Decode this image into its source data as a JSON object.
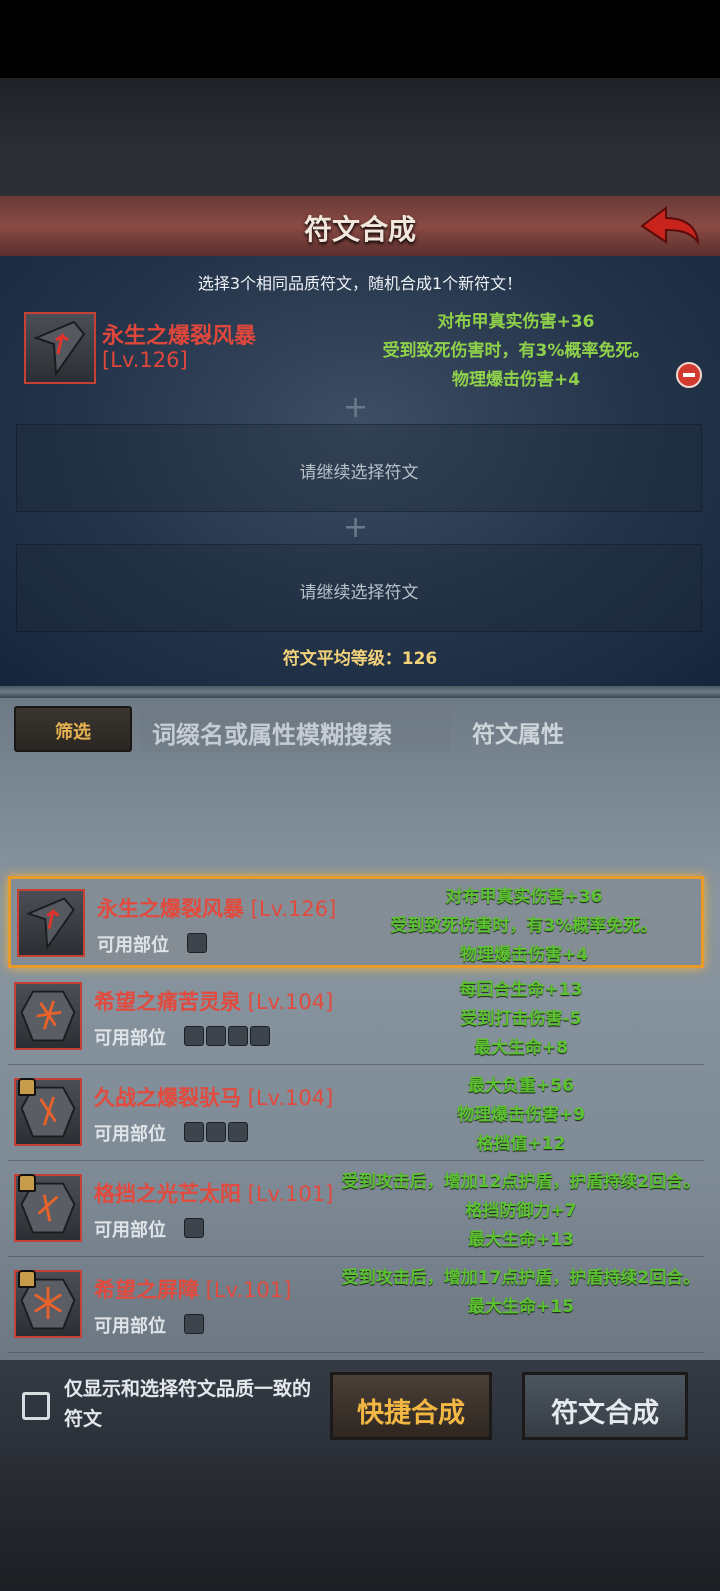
{
  "header": {
    "title": "符文合成"
  },
  "compose": {
    "instruction": "选择3个相同品质符文，随机合成1个新符文！",
    "selected": {
      "name": "永生之爆裂风暴",
      "level": "[Lv.126]",
      "attrs": [
        "对布甲真实伤害+36",
        "受到致死伤害时，有3%概率免死。",
        "物理爆击伤害+4"
      ]
    },
    "empty_slot_text": "请继续选择符文",
    "avg_level": "符文平均等级：126"
  },
  "filters": {
    "filter_label": "筛选",
    "search_placeholder": "词缀名或属性模糊搜索",
    "attr_tab": "符文属性"
  },
  "rune_list": [
    {
      "name": "永生之爆裂风暴",
      "level": " [Lv.126]",
      "slots_label": "可用部位",
      "slot_icon_count": 1,
      "locked": false,
      "selected": true,
      "attrs": [
        "对布甲真实伤害+36",
        "受到致死伤害时，有3%概率免死。",
        "物理爆击伤害+4"
      ]
    },
    {
      "name": "希望之痛苦灵泉",
      "level": " [Lv.104]",
      "slots_label": "可用部位",
      "slot_icon_count": 4,
      "locked": false,
      "selected": false,
      "attrs": [
        "每回合生命+13",
        "受到打击伤害-5",
        "最大生命+8"
      ]
    },
    {
      "name": "久战之爆裂驮马",
      "level": " [Lv.104]",
      "slots_label": "可用部位",
      "slot_icon_count": 3,
      "locked": true,
      "selected": false,
      "attrs": [
        "最大负重+56",
        "物理爆击伤害+9",
        "格挡值+12"
      ]
    },
    {
      "name": "格挡之光芒太阳",
      "level": " [Lv.101]",
      "slots_label": "可用部位",
      "slot_icon_count": 1,
      "locked": true,
      "selected": false,
      "attrs": [
        "受到攻击后，增加12点护盾，护盾持续2回合。",
        "格挡防御力+7",
        "最大生命+13"
      ]
    },
    {
      "name": "希望之屏障",
      "level": " [Lv.101]",
      "slots_label": "可用部位",
      "slot_icon_count": 1,
      "locked": true,
      "selected": false,
      "attrs": [
        "受到攻击后，增加17点护盾，护盾持续2回合。",
        "最大生命+15"
      ]
    }
  ],
  "footer": {
    "checkbox_label": "仅显示和选择符文品质一致的符文",
    "checkbox_checked": false,
    "quick_button": "快捷合成",
    "combine_button": "符文合成"
  },
  "colors": {
    "accent_red": "#e0473c",
    "attr_green": "#8fd14a",
    "gold": "#f2b642",
    "highlight_border": "#e89a2a"
  }
}
